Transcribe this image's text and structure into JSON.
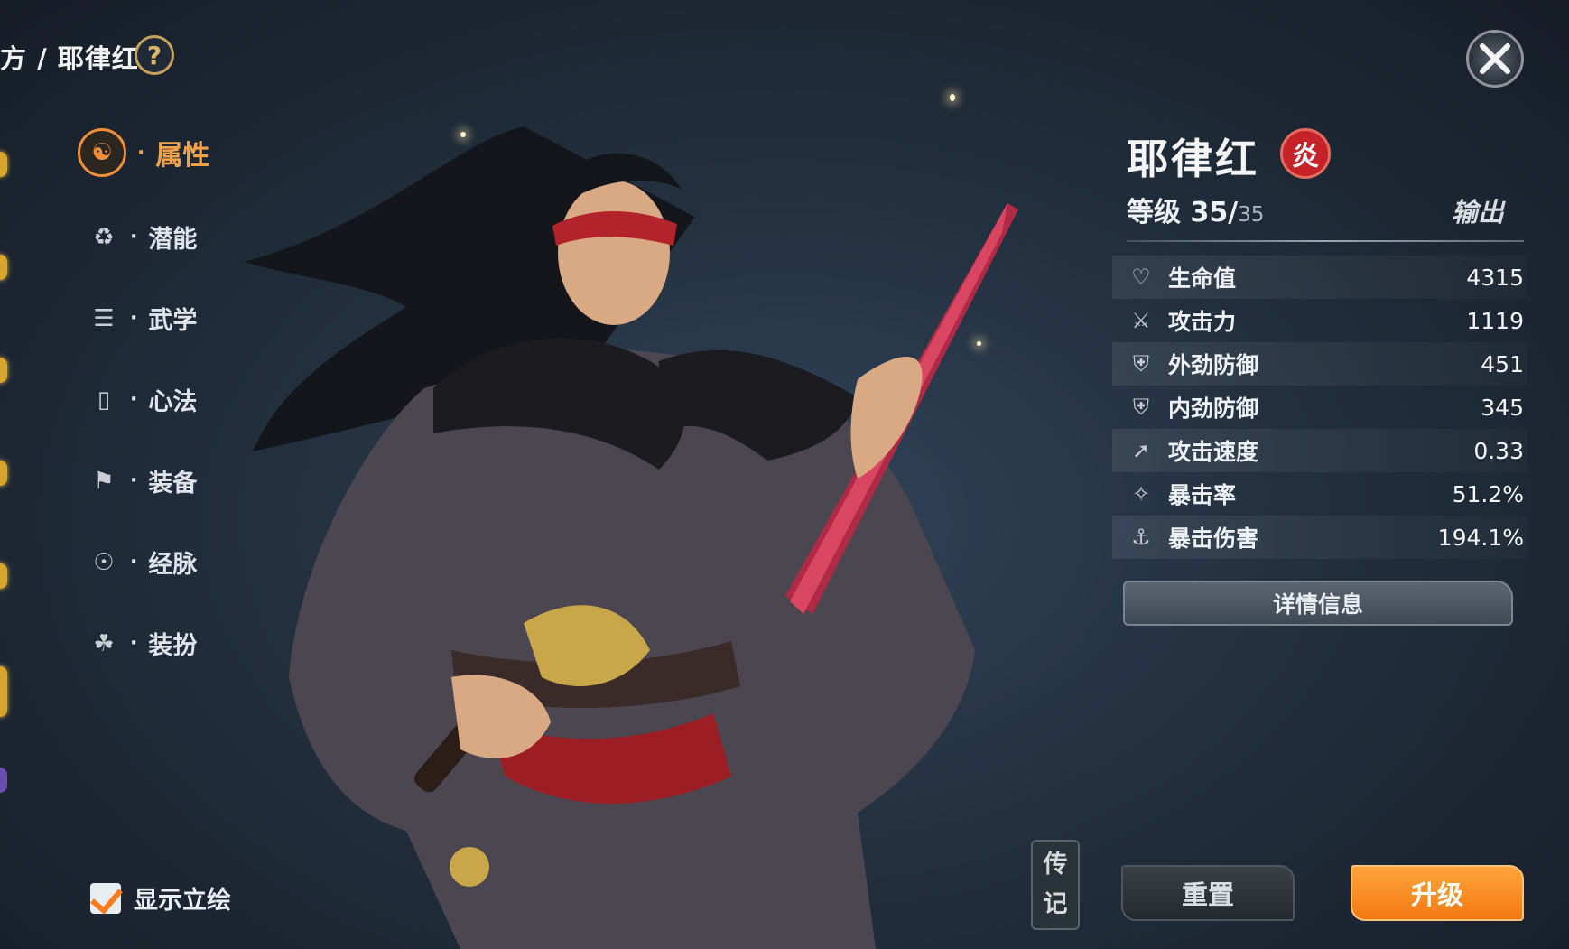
{
  "header": {
    "breadcrumb": "方 / 耶律红",
    "help_label": "?"
  },
  "nav": {
    "items": [
      {
        "label": "属性",
        "icon": "attribute-icon",
        "active": true
      },
      {
        "label": "潜能",
        "icon": "potential-icon"
      },
      {
        "label": "武学",
        "icon": "martial-arts-icon"
      },
      {
        "label": "心法",
        "icon": "mind-method-icon"
      },
      {
        "label": "装备",
        "icon": "equipment-icon"
      },
      {
        "label": "经脉",
        "icon": "meridian-icon"
      },
      {
        "label": "装扮",
        "icon": "outfit-icon"
      }
    ],
    "dot": "·"
  },
  "display_portrait": {
    "label": "显示立绘",
    "checked": true
  },
  "character": {
    "name": "耶律红",
    "element": "炎",
    "level_prefix": "等级 35/",
    "level_max": "35",
    "role": "输出"
  },
  "stats": [
    {
      "label": "生命值",
      "value": "4315",
      "icon": "heart-icon"
    },
    {
      "label": "攻击力",
      "value": "1119",
      "icon": "sword-icon"
    },
    {
      "label": "外劲防御",
      "value": "451",
      "icon": "shield-icon"
    },
    {
      "label": "内劲防御",
      "value": "345",
      "icon": "inner-shield-icon"
    },
    {
      "label": "攻击速度",
      "value": "0.33",
      "icon": "attack-speed-icon"
    },
    {
      "label": "暴击率",
      "value": "51.2%",
      "icon": "crit-rate-icon"
    },
    {
      "label": "暴击伤害",
      "value": "194.1%",
      "icon": "crit-damage-icon"
    }
  ],
  "buttons": {
    "detail": "详情信息",
    "bio_line1": "传",
    "bio_line2": "记",
    "reset": "重置",
    "upgrade": "升级"
  },
  "colors": {
    "accent": "#f08f3a",
    "upgrade": "#f7891f",
    "element_badge": "#c5222a"
  }
}
